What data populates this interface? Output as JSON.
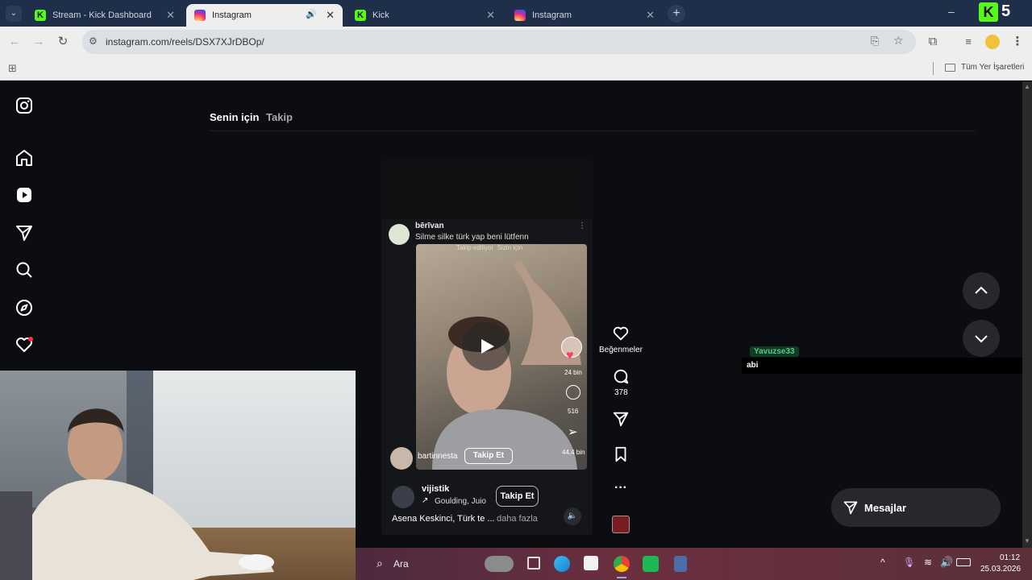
{
  "browser": {
    "tabs": [
      {
        "title": "Stream - Kick Dashboard",
        "icon": "kick-icon",
        "active": false
      },
      {
        "title": "Instagram",
        "icon": "instagram-icon",
        "active": true
      },
      {
        "title": "Kick",
        "icon": "kick-icon",
        "active": false
      },
      {
        "title": "Instagram",
        "icon": "instagram-icon",
        "active": false
      }
    ],
    "new_tab": "+",
    "minimize": "–",
    "url": "instagram.com/reels/DSX7XJrDBOp/",
    "bookmarks_label": "Tüm Yer İşaretleri",
    "kick_badge": "5"
  },
  "instagram": {
    "feed_tabs": {
      "for_you": "Senin için",
      "following": "Takip"
    },
    "reel": {
      "inner_author": "bērīvan",
      "inner_caption": "Silme silke türk yap beni lütfenn",
      "inner_top_text": "Takip ediliyor  Sizin için",
      "inner_likes": "24 bin",
      "inner_comments": "516",
      "inner_shares": "44,4 bin",
      "inner_user": "bartinnesta",
      "inner_follow": "Takip Et",
      "author": "vijistik",
      "audio": "Goulding, Juio",
      "follow": "Takip Et",
      "caption": "Asena Keskinci, Türk te ...",
      "more": "daha fazla"
    },
    "actions": {
      "likes_label": "Beğenmeler",
      "comments": "378"
    },
    "messages_label": "Mesajlar",
    "chat": {
      "user": "Yavuzse33",
      "message": "abi"
    }
  },
  "taskbar": {
    "search": "Ara",
    "time": "01:12",
    "date": "25.03.2026"
  },
  "colors": {
    "ig_bg": "#0c0d10",
    "kick_green": "#53fc18",
    "chat_user": "#57c785",
    "notification": "#ff3040"
  }
}
